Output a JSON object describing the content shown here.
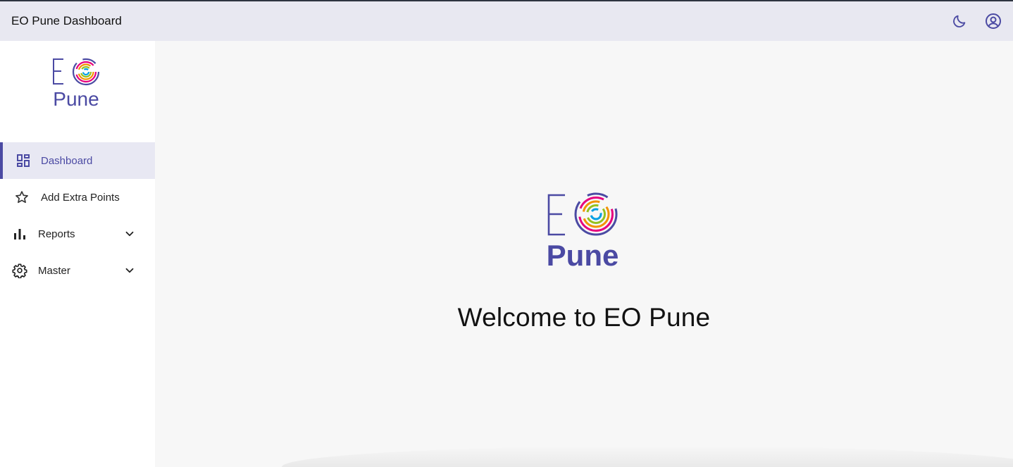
{
  "header": {
    "title": "EO Pune Dashboard",
    "actions": [
      {
        "name": "theme-toggle",
        "icon": "moon-icon"
      },
      {
        "name": "account",
        "icon": "user-circle-icon"
      }
    ]
  },
  "brand": {
    "logo_letters": "EO",
    "logo_city": "Pune",
    "colors": {
      "primary": "#4b4aa3",
      "ring1": "#e6007e",
      "ring2": "#f39200",
      "ring3": "#95c11f",
      "ring4": "#009fe3",
      "ring5": "#8a2be2"
    }
  },
  "sidebar": {
    "items": [
      {
        "label": "Dashboard",
        "icon": "dashboard-icon",
        "active": true
      },
      {
        "label": "Add Extra Points",
        "icon": "star-icon",
        "active": false
      },
      {
        "label": "Reports",
        "icon": "bar-chart-icon",
        "expandable": true
      },
      {
        "label": "Master",
        "icon": "gear-icon",
        "expandable": true
      }
    ]
  },
  "main": {
    "welcome": "Welcome to EO Pune"
  }
}
